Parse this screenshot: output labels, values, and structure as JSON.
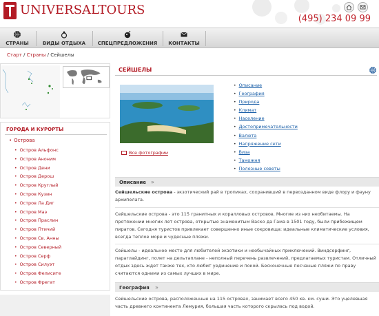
{
  "header": {
    "brand": "UNIVERSALTOURS",
    "phone": "(495) 234 09 99"
  },
  "nav": {
    "items": [
      {
        "label": "СТРАНЫ",
        "icon": "basketball-icon"
      },
      {
        "label": "ВИДЫ ОТДЫХА",
        "icon": "ring-icon"
      },
      {
        "label": "СПЕЦПРЕДЛОЖЕНИЯ",
        "icon": "bomb-icon"
      },
      {
        "label": "КОНТАКТЫ",
        "icon": "envelope-icon"
      }
    ]
  },
  "breadcrumb": {
    "start": "Старт",
    "countries": "Страны",
    "current": "Сейшелы",
    "sep": " / "
  },
  "sidebar": {
    "cities_title": "ГОРОДА И КУРОРТЫ",
    "region": "Острова",
    "cities": [
      "Остров Альфонс",
      "Остров Аноним",
      "Остров Дени",
      "Остров Дерош",
      "Остров Круглый",
      "Остров Кузин",
      "Остров Ла Диг",
      "Остров Маэ",
      "Остров Праслин",
      "Остров Птичий",
      "Остров Св. Анны",
      "Остров Северный",
      "Остров Серф",
      "Остров Силуэт",
      "Остров Фелисите",
      "Остров Фрегат"
    ]
  },
  "main": {
    "title": "СЕЙШЕЛЫ",
    "all_photos": "Все фотографии",
    "topics": [
      "Описание",
      "География",
      "Природа",
      "Климат",
      "Население",
      "Достопримечательности",
      "Валюта",
      "Напряжение сети",
      "Виза",
      "Таможня",
      "Полезные советы"
    ],
    "section1": {
      "label": "Описание",
      "p1_bold": "Сейшельские острова",
      "p1_rest": " - экзотический рай в тропиках, сохранивший в первозданном виде флору и фауну архипелага.",
      "p2": "Сейшельские острова - это 115 гранитных и коралловых островов. Многие из них необитаемы. На протяжении многих лет острова, открытые знаменитым Васко да Гама в 1501 году, были прибежищем пиратов. Сегодня туристов привлекает совершенно иные сокровища: идеальные климатические условия, всегда теплое море и чудесные пляжи.",
      "p3": "Сейшелы - идеальное место для любителей экзотики и необычайных приключений. Виндсерфинг, параглайдинг, полет на дельтаплане - неполный перечень развлечений, предлагаемых туристам. Отличный отдых здесь ждет также тех, кто любит уединение и покой. Бесконечные песчаные пляжи по праву считаются одними из самых лучших в мире."
    },
    "section2": {
      "label": "География",
      "p1": "Сейшельские острова, расположенные на 115 островах, занимает всего 450 кв. км. суши. Это уцелевшая часть древнего континента Лемурия, большая часть которого скрылась под водой."
    }
  },
  "colors": {
    "brand_red": "#b31b25",
    "link_blue": "#1a5fa8",
    "section_bg": "#e8e8e8"
  }
}
